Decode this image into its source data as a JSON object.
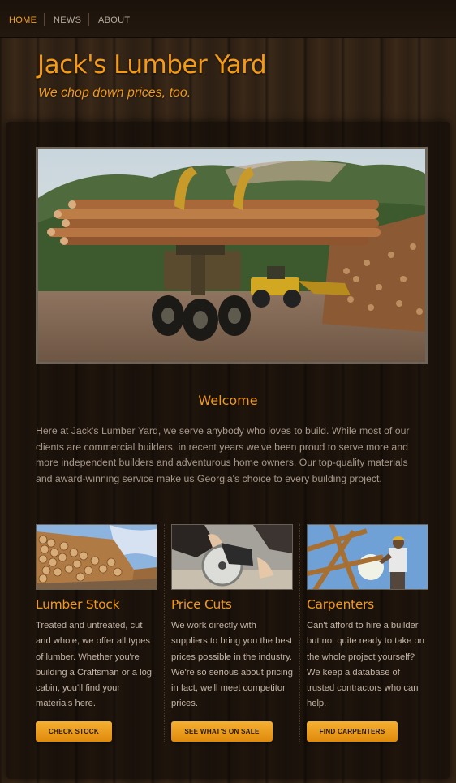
{
  "nav": {
    "items": [
      {
        "label": "HOME",
        "active": true
      },
      {
        "label": "NEWS",
        "active": false
      },
      {
        "label": "ABOUT",
        "active": false
      }
    ]
  },
  "header": {
    "title": "Jack's Lumber Yard",
    "tagline": "We chop down prices, too."
  },
  "hero": {
    "image": "log-loader-carrying-timber-photo"
  },
  "welcome": {
    "heading": "Welcome",
    "body": "Here at Jack's Lumber Yard, we serve anybody who loves to build. While most of our clients are commercial builders, in recent years we've been proud to serve more and more independent builders and adventurous home owners. Our top-quality materials and award-winning service make us Georgia's choice to every building project."
  },
  "features": [
    {
      "image": "stacked-logs-photo",
      "title": "Lumber Stock",
      "text": "Treated and untreated, cut and whole, we offer all types of lumber. Whether you're building a Craftsman or a log cabin, you'll find your materials here.",
      "button": "CHECK STOCK"
    },
    {
      "image": "circular-saw-photo",
      "title": "Price Cuts",
      "text": "We work directly with suppliers to bring you the best prices possible in the industry. We're so serious about pricing in fact, we'll meet competitor prices.",
      "button": "SEE WHAT'S ON SALE"
    },
    {
      "image": "carpenter-framing-photo",
      "title": "Carpenters",
      "text": "Can't afford to hire a builder but not quite ready to take on the whole project yourself? We keep a database of trusted contractors who can help.",
      "button": "FIND CARPENTERS"
    }
  ],
  "colors": {
    "accent": "#f39a16",
    "button": "#f0a21f",
    "wood_dark": "#2a1d12"
  }
}
